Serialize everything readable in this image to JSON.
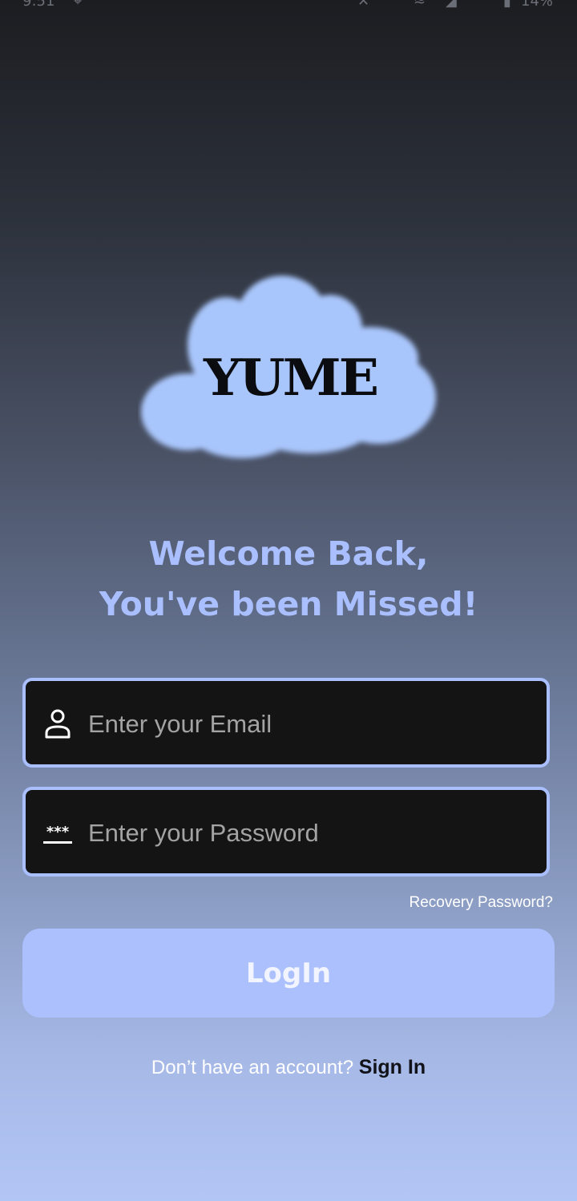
{
  "status_bar": {
    "time": "9:51",
    "battery": "14%"
  },
  "logo": {
    "text": "YUME",
    "cloud_color": "#a9c6fc"
  },
  "welcome": {
    "line1": "Welcome Back,",
    "line2": "You've been Missed!"
  },
  "form": {
    "email": {
      "placeholder": "Enter your Email",
      "value": "",
      "icon": "person-icon"
    },
    "password": {
      "placeholder": "Enter your Password",
      "value": "",
      "icon": "password-dots-icon"
    },
    "recovery_label": "Recovery Password?",
    "login_label": "LogIn"
  },
  "signup": {
    "prompt": "Don’t have an account?",
    "link_label": "Sign In"
  },
  "colors": {
    "accent": "#aabfff",
    "field_bg": "#141414",
    "button_bg": "#abc0fd"
  }
}
